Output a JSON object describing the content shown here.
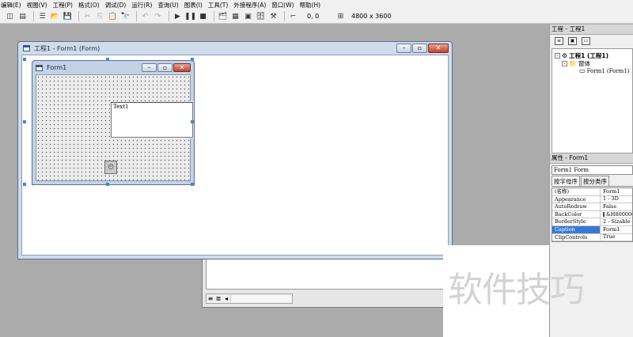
{
  "menu": {
    "items": [
      "编辑(E)",
      "视图(V)",
      "工程(P)",
      "格式(O)",
      "调试(D)",
      "运行(R)",
      "查询(U)",
      "图表(I)",
      "工具(T)",
      "外接程序(A)",
      "窗口(W)",
      "帮助(H)"
    ]
  },
  "toolbar": {
    "position_readout": "0, 0",
    "size_readout": "4800 x 3600"
  },
  "designer_window": {
    "title": "工程1 - Form1 (Form)"
  },
  "form1": {
    "caption": "Form1",
    "textbox_text": "Text1"
  },
  "project_panel": {
    "title": "工程 - 工程1",
    "tree": [
      {
        "label": "工程1 (工程1)",
        "level": 0,
        "expander": "-"
      },
      {
        "label": "窗体",
        "level": 1,
        "expander": "-"
      },
      {
        "label": "Form1 (Form1)",
        "level": 2,
        "expander": ""
      }
    ]
  },
  "properties_panel": {
    "title": "属性 - Form1",
    "object_combo": "Form1 Form",
    "tabs": [
      "按字母序",
      "按分类序"
    ],
    "rows": [
      {
        "name": "(名称)",
        "value": "Form1"
      },
      {
        "name": "Appearance",
        "value": "1 - 3D"
      },
      {
        "name": "AutoRedraw",
        "value": "False"
      },
      {
        "name": "BackColor",
        "value": "&H8000000"
      },
      {
        "name": "BorderStyle",
        "value": "2 - Sizable"
      },
      {
        "name": "Caption",
        "value": "Form1",
        "selected": true
      },
      {
        "name": "ClipControls",
        "value": "True"
      }
    ]
  },
  "code_window": {
    "footer_glyphs": [
      "≡",
      "≣",
      "◂"
    ]
  },
  "watermark": {
    "text": "软件技巧"
  }
}
